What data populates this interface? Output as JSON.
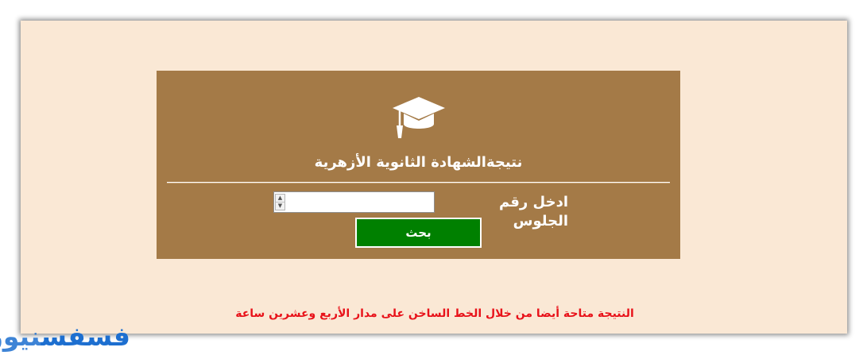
{
  "card": {
    "icon": "graduation-cap-icon",
    "title": "نتيجةالشهادة الثانوية الأزهرية",
    "seat_label": "ادخل رقم الجلوس",
    "seat_input_value": "",
    "search_label": "بحث"
  },
  "footer": {
    "hotline_note": "النتيجة متاحة أيضا من خلال الخط الساخن على مدار الأربع وعشرين ساعة"
  },
  "watermark": {
    "part_1": "فسفس",
    "part_2": "نيوز"
  },
  "colors": {
    "page_background": "#fae8d5",
    "card_background": "#a47a47",
    "button_background": "#008000",
    "note_text": "#e8121a",
    "logo": "#1d6fd0"
  }
}
